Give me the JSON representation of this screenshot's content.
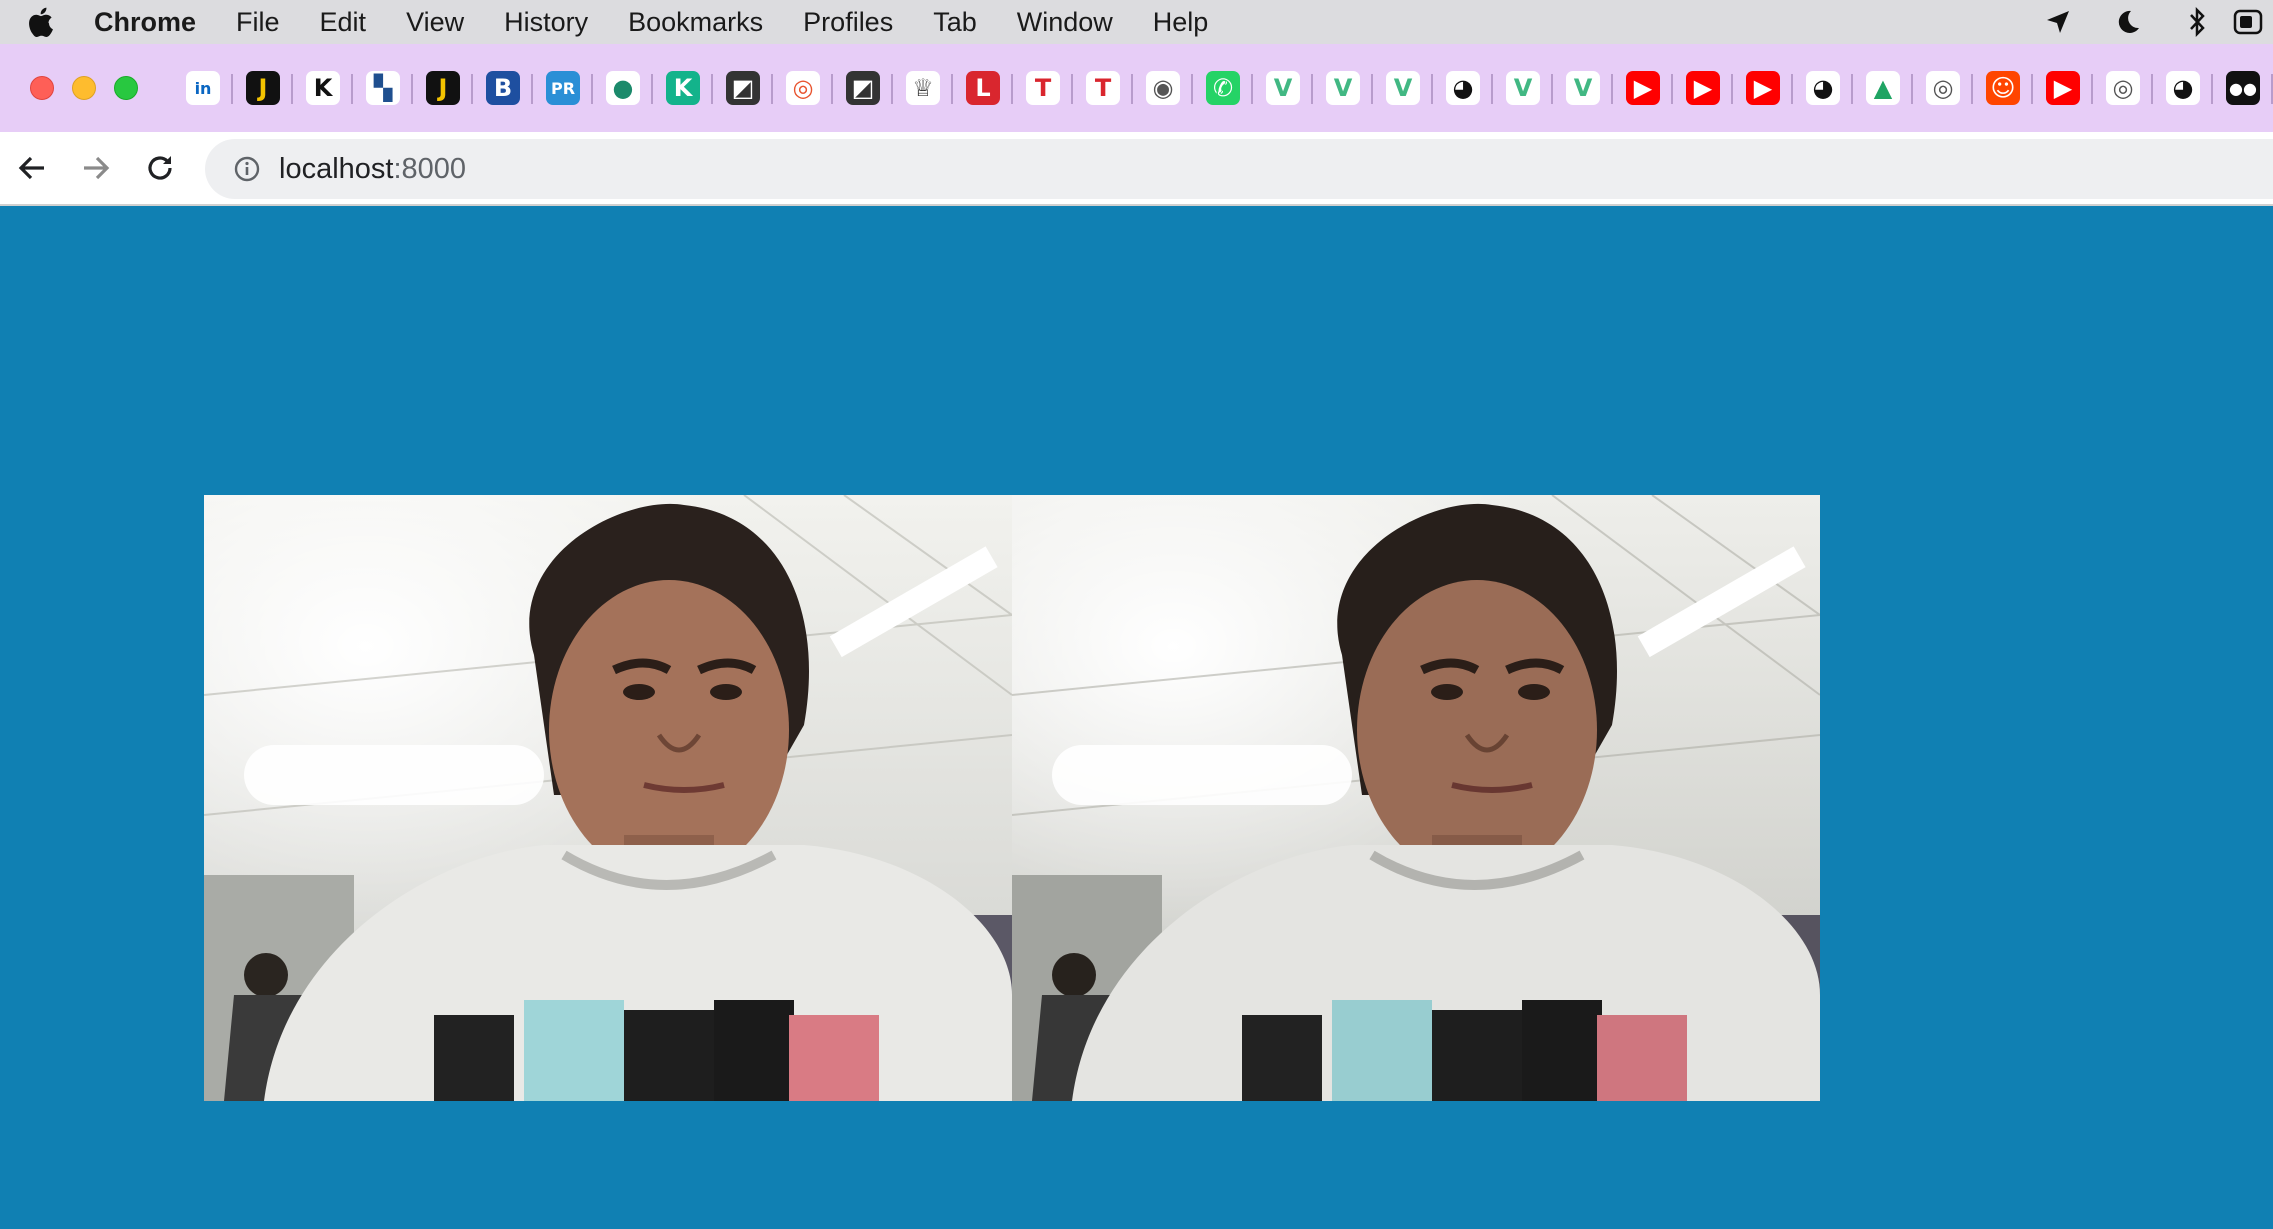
{
  "menubar": {
    "app_name": "Chrome",
    "items": [
      "File",
      "Edit",
      "View",
      "History",
      "Bookmarks",
      "Profiles",
      "Tab",
      "Window",
      "Help"
    ],
    "status_icons": [
      "location-arrow-icon",
      "moon-icon",
      "bluetooth-icon",
      "battery-icon"
    ]
  },
  "bookmarks": [
    {
      "name": "linkedin-icon",
      "glyph": "in",
      "bg": "#ffffff",
      "fg": "#0a66c2"
    },
    {
      "name": "j-icon",
      "glyph": "J",
      "bg": "#111111",
      "fg": "#f5c400"
    },
    {
      "name": "k-icon",
      "glyph": "K",
      "bg": "#ffffff",
      "fg": "#111111"
    },
    {
      "name": "board-icon",
      "glyph": "▚",
      "bg": "#ffffff",
      "fg": "#1f4f8f"
    },
    {
      "name": "j-icon",
      "glyph": "J",
      "bg": "#111111",
      "fg": "#f5c400"
    },
    {
      "name": "b-icon",
      "glyph": "B",
      "bg": "#1e4fa0",
      "fg": "#ffffff"
    },
    {
      "name": "pr-icon",
      "glyph": "PR",
      "bg": "#2a8fd6",
      "fg": "#ffffff"
    },
    {
      "name": "chat-icon",
      "glyph": "●",
      "bg": "#ffffff",
      "fg": "#1b8a6b"
    },
    {
      "name": "k-square-icon",
      "glyph": "K",
      "bg": "#13b38b",
      "fg": "#ffffff"
    },
    {
      "name": "slash-icon",
      "glyph": "◩",
      "bg": "#333333",
      "fg": "#ffffff"
    },
    {
      "name": "ring-icon",
      "glyph": "◎",
      "bg": "#ffffff",
      "fg": "#e8542f"
    },
    {
      "name": "slash-icon",
      "glyph": "◩",
      "bg": "#333333",
      "fg": "#ffffff"
    },
    {
      "name": "badge-icon",
      "glyph": "♕",
      "bg": "#ffffff",
      "fg": "#333333"
    },
    {
      "name": "l-circle-icon",
      "glyph": "L",
      "bg": "#d9262e",
      "fg": "#ffffff"
    },
    {
      "name": "tesla-icon",
      "glyph": "T",
      "bg": "#ffffff",
      "fg": "#d9262e"
    },
    {
      "name": "tesla-icon",
      "glyph": "T",
      "bg": "#ffffff",
      "fg": "#d9262e"
    },
    {
      "name": "globe-icon",
      "glyph": "◉",
      "bg": "#ffffff",
      "fg": "#555555"
    },
    {
      "name": "whatsapp-icon",
      "glyph": "✆",
      "bg": "#25d366",
      "fg": "#ffffff"
    },
    {
      "name": "vue-icon",
      "glyph": "V",
      "bg": "#ffffff",
      "fg": "#41b883"
    },
    {
      "name": "vue-icon",
      "glyph": "V",
      "bg": "#ffffff",
      "fg": "#41b883"
    },
    {
      "name": "vue-icon",
      "glyph": "V",
      "bg": "#ffffff",
      "fg": "#41b883"
    },
    {
      "name": "github-icon",
      "glyph": "◕",
      "bg": "#ffffff",
      "fg": "#111111"
    },
    {
      "name": "vue-icon",
      "glyph": "V",
      "bg": "#ffffff",
      "fg": "#41b883"
    },
    {
      "name": "vue-icon",
      "glyph": "V",
      "bg": "#ffffff",
      "fg": "#41b883"
    },
    {
      "name": "youtube-icon",
      "glyph": "▶",
      "bg": "#ff0000",
      "fg": "#ffffff"
    },
    {
      "name": "youtube-icon",
      "glyph": "▶",
      "bg": "#ff0000",
      "fg": "#ffffff"
    },
    {
      "name": "youtube-icon",
      "glyph": "▶",
      "bg": "#ff0000",
      "fg": "#ffffff"
    },
    {
      "name": "github-icon",
      "glyph": "◕",
      "bg": "#ffffff",
      "fg": "#111111"
    },
    {
      "name": "google-drive-icon",
      "glyph": "▲",
      "bg": "#ffffff",
      "fg": "#1fa463"
    },
    {
      "name": "chrome-icon",
      "glyph": "◎",
      "bg": "#ffffff",
      "fg": "#555555"
    },
    {
      "name": "reddit-icon",
      "glyph": "☺",
      "bg": "#ff4500",
      "fg": "#ffffff"
    },
    {
      "name": "youtube-icon",
      "glyph": "▶",
      "bg": "#ff0000",
      "fg": "#ffffff"
    },
    {
      "name": "chrome-icon",
      "glyph": "◎",
      "bg": "#ffffff",
      "fg": "#555555"
    },
    {
      "name": "github-icon",
      "glyph": "◕",
      "bg": "#ffffff",
      "fg": "#111111"
    },
    {
      "name": "medium-icon",
      "glyph": "●●",
      "bg": "#111111",
      "fg": "#ffffff"
    }
  ],
  "address_bar": {
    "host": "localhost",
    "port": ":8000"
  },
  "page": {
    "background": "#1080b3",
    "photos": [
      "original-photo",
      "filtered-photo"
    ]
  }
}
